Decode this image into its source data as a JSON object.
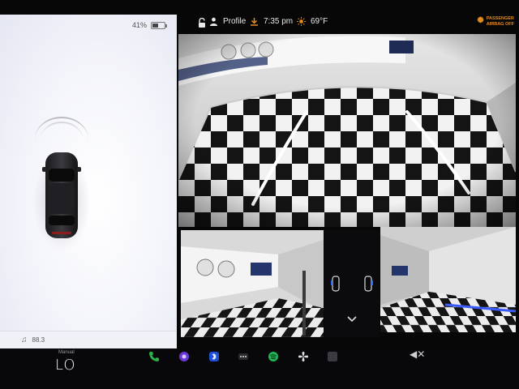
{
  "status": {
    "battery_percent_label": "41%",
    "battery_level": 0.41,
    "profile_label": "Profile",
    "time": "7:35 pm",
    "temperature": "69°F",
    "airbag_line1": "PASSENGER",
    "airbag_line2": "AIRBAG OFF"
  },
  "media": {
    "station": "88.3"
  },
  "drive_mode": {
    "label": "Manual",
    "value": "LO"
  },
  "icons": {
    "lock": "lock-open-icon",
    "profile": "person-icon",
    "clock": "download-icon",
    "weather": "sun-icon",
    "airbag": "airbag-warning-icon",
    "music": "music-note-icon",
    "phone": "phone-icon",
    "camera": "camera-icon",
    "bluetooth": "bluetooth-icon",
    "more": "more-dots-icon",
    "spotify": "spotify-icon",
    "fan": "fan-icon",
    "app": "app-square-icon",
    "mute": "volume-mute-icon",
    "chevron": "chevron-down-icon"
  },
  "colors": {
    "airbag_warning": "#e58a1c",
    "guide_line": "#ffffff",
    "accent_blue": "#2f6bff"
  }
}
